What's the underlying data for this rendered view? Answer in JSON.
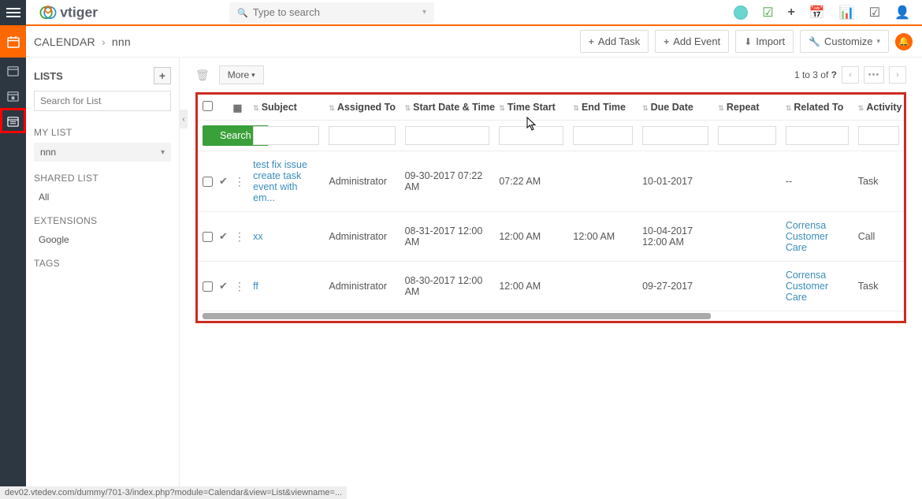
{
  "topbar": {
    "search_placeholder": "Type to search"
  },
  "breadcrumb": {
    "module": "CALENDAR",
    "current": "nnn"
  },
  "actions": {
    "add_task": "Add Task",
    "add_event": "Add Event",
    "import": "Import",
    "customize": "Customize"
  },
  "sidebar": {
    "lists_header": "LISTS",
    "search_placeholder": "Search for List",
    "mylist_label": "MY LIST",
    "selected_list": "nnn",
    "shared_label": "SHARED LIST",
    "shared_items": [
      "All"
    ],
    "extensions_label": "EXTENSIONS",
    "extensions_items": [
      "Google"
    ],
    "tags_label": "TAGS"
  },
  "toolbar": {
    "more_label": "More",
    "pager_text_pre": "1 to 3  of ",
    "pager_total": "?"
  },
  "table": {
    "search_btn": "Search",
    "columns": [
      "Subject",
      "Assigned To",
      "Start Date & Time",
      "Time Start",
      "End Time",
      "Due Date",
      "Repeat",
      "Related To",
      "Activity"
    ],
    "rows": [
      {
        "subject": "test fix issue create task event with em...",
        "assigned_to": "Administrator",
        "start_datetime": "09-30-2017 07:22 AM",
        "time_start": "07:22 AM",
        "end_time": "",
        "due_date": "10-01-2017",
        "repeat": "",
        "related_to": "--",
        "related_link": false,
        "activity": "Task"
      },
      {
        "subject": "xx",
        "assigned_to": "Administrator",
        "start_datetime": "08-31-2017 12:00 AM",
        "time_start": "12:00 AM",
        "end_time": "12:00 AM",
        "due_date": "10-04-2017 12:00 AM",
        "repeat": "",
        "related_to": "Corrensa Customer Care",
        "related_link": true,
        "activity": "Call"
      },
      {
        "subject": "ff",
        "assigned_to": "Administrator",
        "start_datetime": "08-30-2017 12:00 AM",
        "time_start": "12:00 AM",
        "end_time": "",
        "due_date": "09-27-2017",
        "repeat": "",
        "related_to": "Corrensa Customer Care",
        "related_link": true,
        "activity": "Task"
      }
    ]
  },
  "footer": {
    "url": "dev02.vtedev.com/dummy/701-3/index.php?module=Calendar&view=List&viewname=..."
  }
}
